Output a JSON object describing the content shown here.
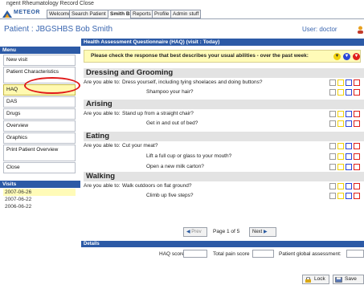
{
  "menubar": {
    "text": "ngent Rheumatology Record Close"
  },
  "brand": {
    "name": "METEOR"
  },
  "tabs": [
    {
      "label": "Welcome",
      "active": false
    },
    {
      "label": "Search Patient",
      "active": false
    },
    {
      "label": "Smith B.",
      "active": true
    },
    {
      "label": "Reports",
      "active": false
    },
    {
      "label": "Profile",
      "active": false
    },
    {
      "label": "Admin stuff",
      "active": false
    }
  ],
  "patient": {
    "title": "Patient : JBGSHBS Bob Smith",
    "user": "User: doctor"
  },
  "sidebar": {
    "menu_header": "Menu",
    "items": [
      {
        "label": "New visit"
      },
      {
        "label": "Patient Characteristics"
      },
      {
        "label": "HAQ"
      },
      {
        "label": "DAS"
      },
      {
        "label": "Drugs"
      },
      {
        "label": "Overview"
      },
      {
        "label": "Graphics"
      },
      {
        "label": "Print Patient Overview"
      },
      {
        "label": "Close"
      }
    ],
    "visits_header": "Visits",
    "visits": [
      "2007-06-26",
      "2007-06-22",
      "2006-06-22"
    ]
  },
  "main": {
    "header": "Health Assessment Questionnaire (HAQ) (visit : Today)",
    "instruction": "Please check the response that best describes your usual abilities - over the past week:",
    "sections": [
      {
        "title": "Dressing and Grooming",
        "questions": [
          {
            "prefix": "Are you able to:",
            "text": "Dress yourself, including tying shoelaces and doing buttons?"
          },
          {
            "prefix": "",
            "text": "Shampoo your hair?"
          }
        ]
      },
      {
        "title": "Arising",
        "questions": [
          {
            "prefix": "Are you able to:",
            "text": "Stand up from a straight chair?"
          },
          {
            "prefix": "",
            "text": "Get in and out of bed?"
          }
        ]
      },
      {
        "title": "Eating",
        "questions": [
          {
            "prefix": "Are you able to:",
            "text": "Cut your meat?"
          },
          {
            "prefix": "",
            "text": "Lift a full cup or glass to your mouth?"
          },
          {
            "prefix": "",
            "text": "Open a new milk carton?"
          }
        ]
      },
      {
        "title": "Walking",
        "questions": [
          {
            "prefix": "Are you able to:",
            "text": "Walk outdoors on flat ground?"
          },
          {
            "prefix": "",
            "text": "Climb up five steps?"
          }
        ]
      }
    ],
    "pager": {
      "prev": "Prev",
      "page_text": "Page 1 of 5",
      "next": "Next"
    }
  },
  "details": {
    "header": "Details",
    "haq_score_label": "HAQ score",
    "total_pain_label": "Total pain score",
    "patient_global_label": "Patient global assessment:"
  },
  "footer": {
    "lock": "Lock",
    "save": "Save"
  },
  "colors": {
    "accent": "#2c5aa6",
    "highlight": "#fffbb8",
    "title_blue": "#3a66b0",
    "box_yellow": "#f1d20c",
    "box_blue": "#2a46d8",
    "box_red": "#e0201a",
    "marker_red": "#e01818"
  }
}
